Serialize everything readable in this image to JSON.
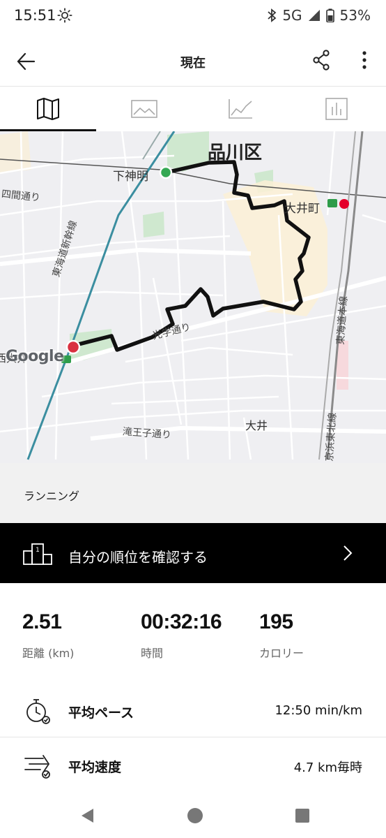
{
  "status_bar": {
    "time": "15:51",
    "network": "5G",
    "battery": "53%",
    "icons": [
      "sun-icon",
      "bluetooth-icon",
      "signal-icon",
      "battery-icon"
    ]
  },
  "header": {
    "title": "現在",
    "icons": [
      "back-arrow-icon",
      "share-icon",
      "more-vert-icon"
    ]
  },
  "tabs": [
    {
      "icon": "map-icon",
      "active": true
    },
    {
      "icon": "image-icon",
      "active": false
    },
    {
      "icon": "line-chart-icon",
      "active": false
    },
    {
      "icon": "bar-chart-icon",
      "active": false
    }
  ],
  "map": {
    "labels": {
      "ward": "品川区",
      "start_station": "下神明",
      "oimachi": "大井町",
      "yomamachi": "四間通り",
      "shinkansen": "東海道新幹線",
      "tokaido": "東海道本線",
      "keihin": "京浜東北線",
      "kogaku": "光学通り",
      "takioji": "滝王子通り",
      "oi": "大井",
      "partial_station": "西大井"
    },
    "logo": "Google",
    "colors": {
      "route": "#111111",
      "start_marker": "#34a853",
      "end_marker": "#d93040"
    }
  },
  "activity": {
    "type": "ランニング"
  },
  "ranking": {
    "label": "自分の順位を確認する"
  },
  "stats": [
    {
      "value": "2.51",
      "label": "距離 (km)"
    },
    {
      "value": "00:32:16",
      "label": "時間"
    },
    {
      "value": "195",
      "label": "カロリー"
    }
  ],
  "metrics": [
    {
      "icon": "stopwatch-icon",
      "label": "平均ペース",
      "value": "12:50 min/km"
    },
    {
      "icon": "speed-icon",
      "label": "平均速度",
      "value": "4.7 km毎時"
    }
  ]
}
